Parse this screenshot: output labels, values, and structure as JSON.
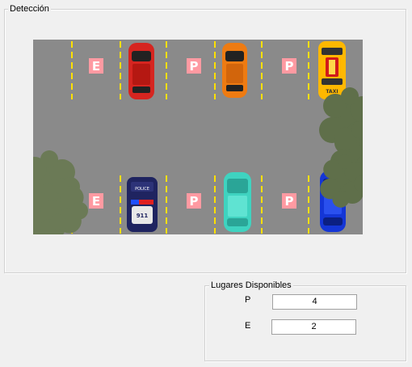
{
  "deteccion": {
    "title": "Detección"
  },
  "parking": {
    "top_labels": [
      "E",
      "P",
      "P"
    ],
    "bottom_labels": [
      "E",
      "P",
      "P"
    ],
    "colors": {
      "asphalt": "#8a8a8a",
      "line": "#ffe000",
      "sign": "#ff9aa2",
      "red_car": "#d62520",
      "orange_car": "#ee7b12",
      "taxi": "#ffb800",
      "police_car": "#1f2460",
      "teal_car": "#3fd3c0",
      "blue_car": "#1436d6",
      "tree": "#6b7a56"
    },
    "taxi_text": "TAXI",
    "police_text": "POLICE",
    "police_number": "911"
  },
  "lugares": {
    "title": "Lugares Disponibles",
    "p_label": "P",
    "p_value": "4",
    "e_label": "E",
    "e_value": "2"
  }
}
